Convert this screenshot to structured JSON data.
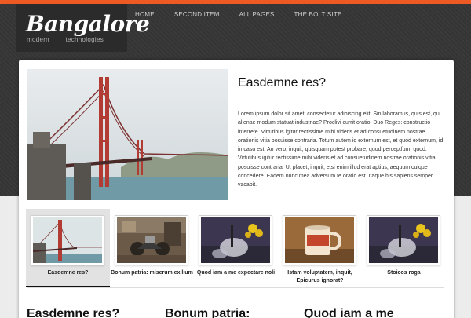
{
  "colors": {
    "accent": "#ef5a24",
    "header": "#3a3a3a"
  },
  "site": {
    "title": "Bangalore",
    "tagline_left": "modern",
    "tagline_right": "technologies"
  },
  "nav": [
    {
      "label": "HOME"
    },
    {
      "label": "SECOND ITEM"
    },
    {
      "label": "ALL PAGES"
    },
    {
      "label": "THE BOLT SITE"
    }
  ],
  "feature": {
    "title": "Easdemne res?",
    "body": "Lorem ipsum dolor sit amet, consectetur adipiscing elit. Sin laboramus, quis est, qui alienae modum statuat industriae? Proclivi currit oratio. Duo Reges: constructio interrete. Virtutibus igitur rectissime mihi videris et ad consuetudinem nostrae orationis vitia posuisse contraria. Totum autem id externum est, et quod externum, id in casu est. An vero, inquit, quisquam potest probare, quod perceptfum, quod. Virtutibus igitur rectissime mihi videris et ad consuetudinem nostrae orationis vitia posuisse contraria. Ut placet, inquit, etsi enim illud erat aptius, aequum cuique concedere. Eadem nunc mea adversum te oratio est. Itaque his sapiens semper vacabit."
  },
  "thumbs": [
    {
      "caption": "Easdemne res?",
      "image": "golden-gate-bridge"
    },
    {
      "caption": "Bonum patria: miserum exilium",
      "image": "motorcycle-garage"
    },
    {
      "caption": "Quod iam a me expectare noli",
      "image": "teapot-flowers"
    },
    {
      "caption": "Istam voluptatem, inquit, Epicurus ignorat?",
      "image": "tea-mug"
    },
    {
      "caption": "Stoicos roga",
      "image": "teapot-flowers"
    }
  ],
  "sections": [
    {
      "heading": "Easdemne res?"
    },
    {
      "heading": "Bonum patria:"
    },
    {
      "heading": "Quod iam a me"
    }
  ]
}
